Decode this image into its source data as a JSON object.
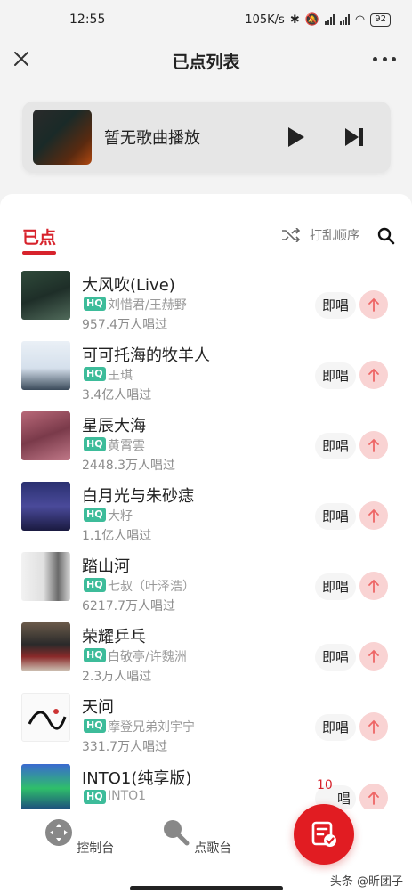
{
  "status_bar": {
    "time": "12:55",
    "network_speed": "105K/s",
    "battery": "92"
  },
  "header": {
    "title": "已点列表"
  },
  "now_playing": {
    "text": "暂无歌曲播放"
  },
  "tabs": {
    "active": "已点",
    "shuffle_label": "打乱顺序"
  },
  "songs": [
    {
      "title": "大风吹(Live)",
      "quality": "HQ",
      "artist": "刘惜君/王赫野",
      "plays": "957.4万人唱过",
      "action": "即唱"
    },
    {
      "title": "可可托海的牧羊人",
      "quality": "HQ",
      "artist": "王琪",
      "plays": "3.4亿人唱过",
      "action": "即唱"
    },
    {
      "title": "星辰大海",
      "quality": "HQ",
      "artist": "黄霄雲",
      "plays": "2448.3万人唱过",
      "action": "即唱"
    },
    {
      "title": "白月光与朱砂痣",
      "quality": "HQ",
      "artist": "大籽",
      "plays": "1.1亿人唱过",
      "action": "即唱"
    },
    {
      "title": "踏山河",
      "quality": "HQ",
      "artist": "七叔（叶泽浩）",
      "plays": "6217.7万人唱过",
      "action": "即唱"
    },
    {
      "title": "荣耀乒乓",
      "quality": "HQ",
      "artist": "白敬亭/许魏洲",
      "plays": "2.3万人唱过",
      "action": "即唱"
    },
    {
      "title": "天问",
      "quality": "HQ",
      "artist": "摩登兄弟刘宇宁",
      "plays": "331.7万人唱过",
      "action": "即唱"
    },
    {
      "title": "INTO1(纯享版)",
      "quality": "HQ",
      "artist": "INTO1",
      "plays": "",
      "action": "唱",
      "badge": "10"
    }
  ],
  "bottom_nav": {
    "console": "控制台",
    "song_request": "点歌台"
  },
  "watermark": "头条 @昕团子",
  "colors": {
    "accent": "#d7232c",
    "hq_badge": "#3dbc9a",
    "fab": "#e11c22"
  }
}
